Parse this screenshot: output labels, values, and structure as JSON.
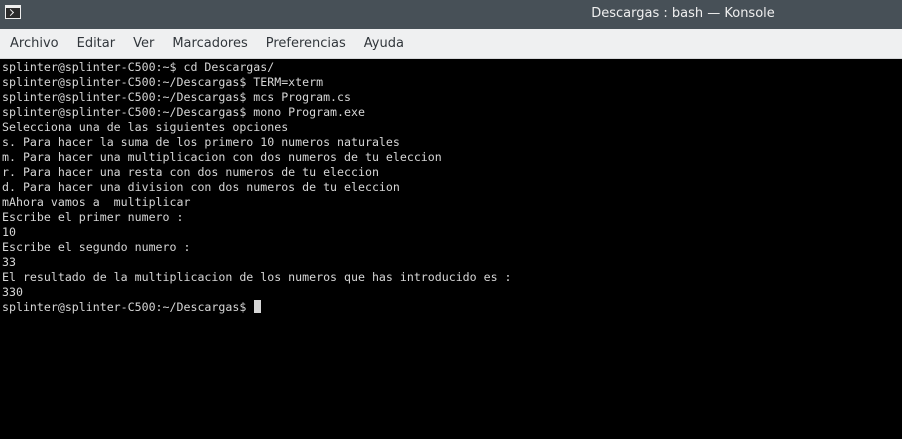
{
  "window": {
    "title": "Descargas : bash — Konsole",
    "icon": "konsole-terminal-icon"
  },
  "menubar": {
    "items": [
      "Archivo",
      "Editar",
      "Ver",
      "Marcadores",
      "Preferencias",
      "Ayuda"
    ]
  },
  "terminal": {
    "lines": [
      "splinter@splinter-C500:~$ cd Descargas/",
      "splinter@splinter-C500:~/Descargas$ TERM=xterm",
      "splinter@splinter-C500:~/Descargas$ mcs Program.cs",
      "splinter@splinter-C500:~/Descargas$ mono Program.exe",
      "Selecciona una de las siguientes opciones",
      "s. Para hacer la suma de los primero 10 numeros naturales",
      "m. Para hacer una multiplicacion con dos numeros de tu eleccion",
      "r. Para hacer una resta con dos numeros de tu eleccion",
      "d. Para hacer una division con dos numeros de tu eleccion",
      "mAhora vamos a  multiplicar",
      "Escribe el primer numero :",
      "10",
      "Escribe el segundo numero :",
      "33",
      "El resultado de la multiplicacion de los numeros que has introducido es :",
      "330"
    ],
    "prompt": "splinter@splinter-C500:~/Descargas$ "
  },
  "colors": {
    "titlebar": "#475057",
    "menubar": "#eff0f1",
    "terminal_bg": "#000000",
    "terminal_fg": "#d6d6d6"
  }
}
